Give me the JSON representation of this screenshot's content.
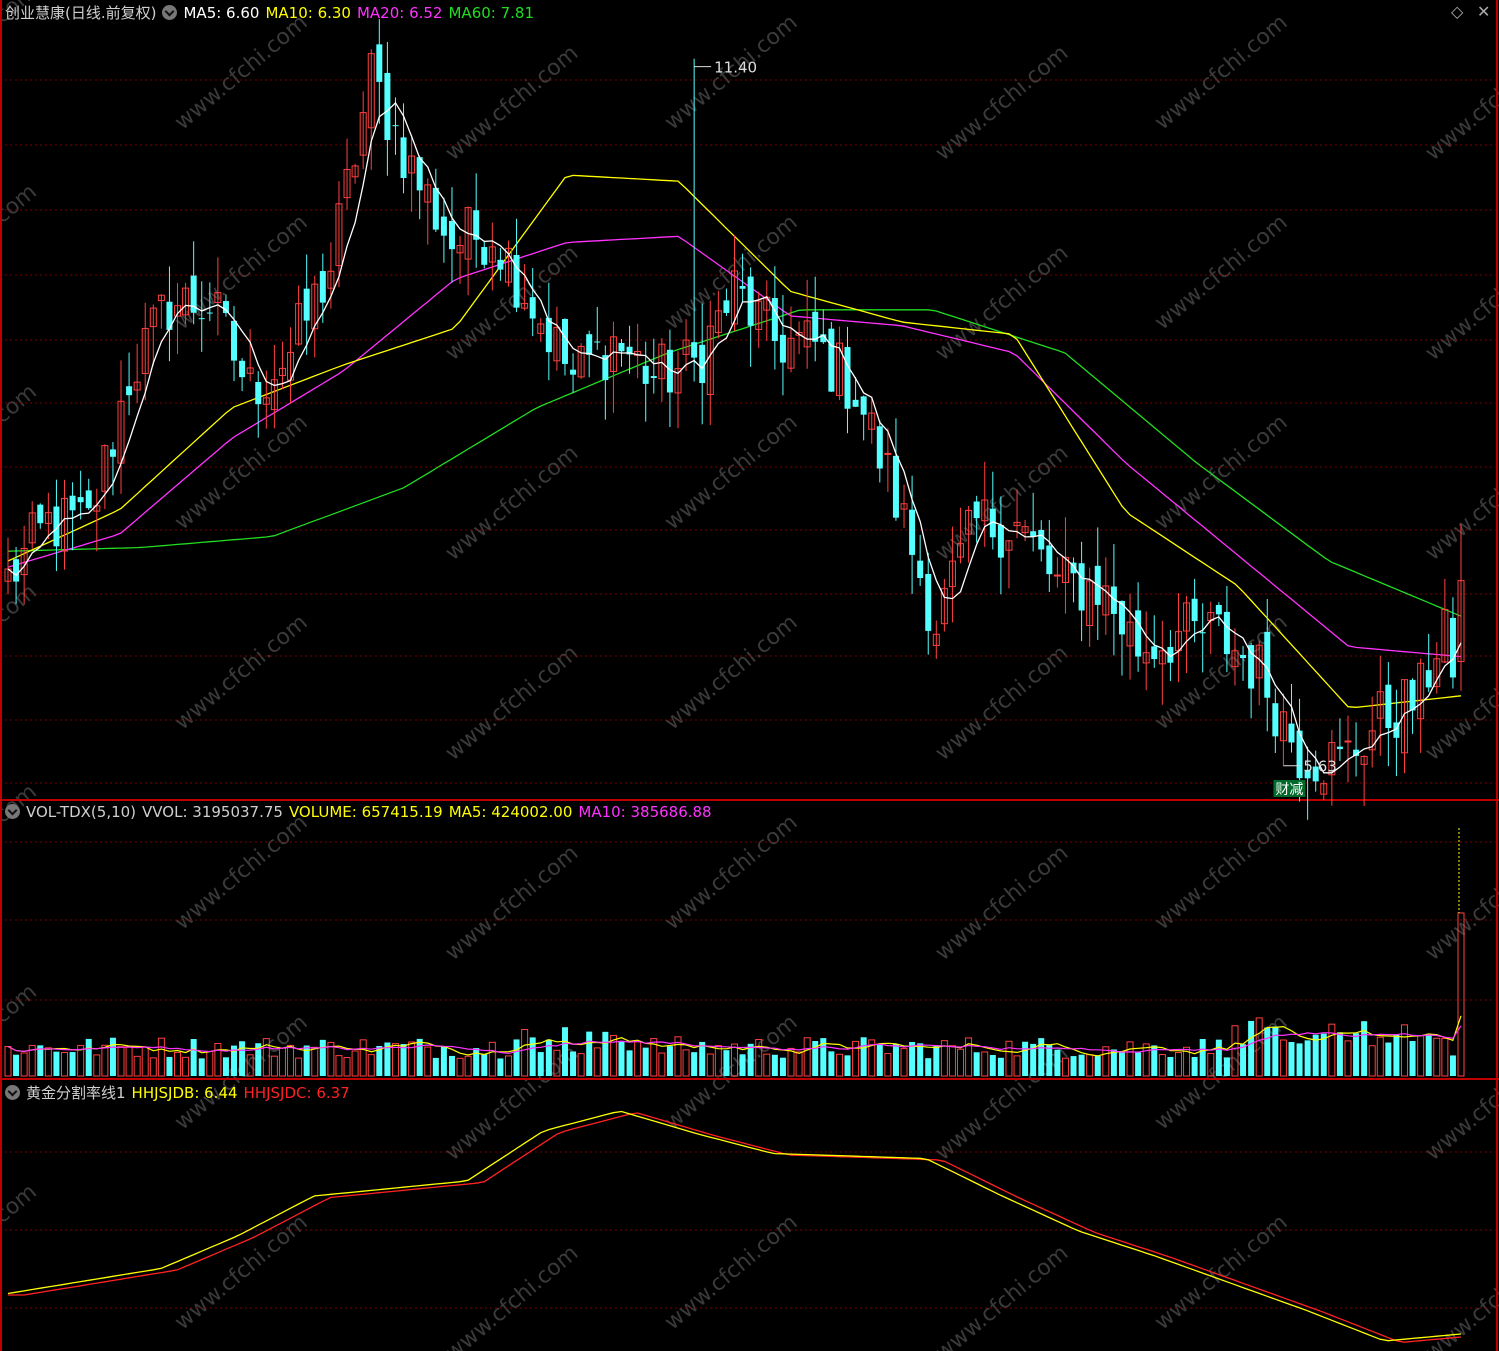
{
  "price_header": {
    "title": "创业慧康(日线.前复权)",
    "ma5": "MA5: 6.60",
    "ma10": "MA10: 6.30",
    "ma20": "MA20: 6.52",
    "ma60": "MA60: 7.81"
  },
  "volume_header": {
    "indicator": "VOL-TDX(5,10)",
    "vvol": "VVOL: 3195037.75",
    "volume": "VOLUME: 657415.19",
    "ma5": "MA5: 424002.00",
    "ma10": "MA10: 385686.88"
  },
  "golden_header": {
    "indicator": "黄金分割率线1",
    "hhjsjdb": "HHJSJDB: 6.44",
    "hhjsjdc": "HHJSJDC: 6.37"
  },
  "annotations": {
    "high": "11.40",
    "low": "5.63",
    "tag": "财减"
  },
  "watermark": "www.cfchi.com",
  "colors": {
    "up": "#ff4040",
    "down": "#54ffff",
    "ma5": "#ffffff",
    "ma10": "#ffff00",
    "ma20": "#ff33ff",
    "ma60": "#22dd22",
    "golden_b": "#ffff00",
    "golden_c": "#ff2222",
    "frame": "#c00000"
  },
  "chart_data": {
    "type": "candlestick",
    "ma60_anchors": [
      7.38,
      7.41,
      7.5,
      7.9,
      8.55,
      9.0,
      9.35,
      9.35,
      9.0,
      8.1,
      7.3,
      6.85
    ],
    "ma20_anchors": [
      7.25,
      7.52,
      8.3,
      8.85,
      9.6,
      9.9,
      9.95,
      9.3,
      9.22,
      9.0,
      8.1,
      7.35,
      6.6,
      6.52
    ],
    "ma10_anchors": [
      7.3,
      7.72,
      8.55,
      8.9,
      9.2,
      10.45,
      10.4,
      9.5,
      9.25,
      9.15,
      7.7,
      7.1,
      6.1,
      6.2
    ],
    "price_anchors": [
      7.15,
      7.6,
      7.6,
      8.8,
      9.4,
      9.4,
      8.7,
      9.0,
      9.7,
      11.25,
      10.5,
      9.9,
      10.0,
      9.4,
      8.8,
      9.1,
      8.8,
      8.9,
      9.5,
      9.1,
      9.05,
      8.7,
      7.8,
      6.8,
      7.6,
      7.6,
      7.1,
      7.1,
      6.6,
      6.7,
      6.7,
      6.4,
      5.75,
      5.65,
      6.0,
      6.2,
      7.3
    ],
    "low": 5.63,
    "high": 11.4,
    "last_close": 7.14,
    "volume_last": 657415.19,
    "volume_ma5": 424002.0,
    "volume_ma10": 385686.88,
    "golden_last_b": 6.44,
    "golden_last_c": 6.37
  }
}
